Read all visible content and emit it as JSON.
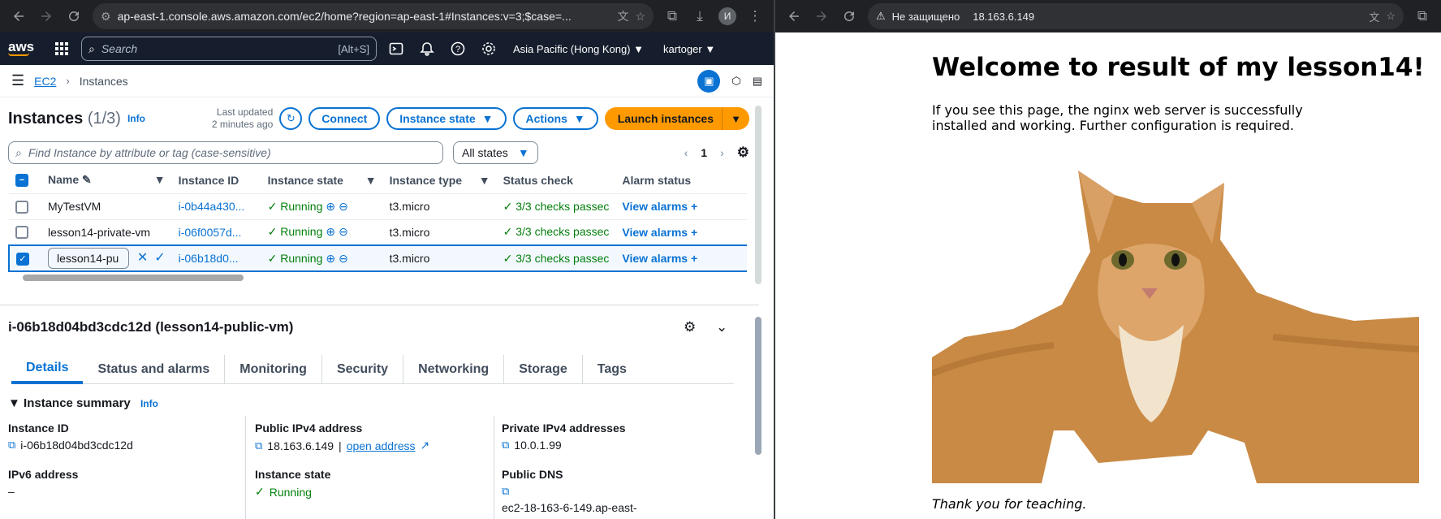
{
  "left_browser": {
    "url": "ap-east-1.console.aws.amazon.com/ec2/home?region=ap-east-1#Instances:v=3;$case=...",
    "profile_initial": "И"
  },
  "aws_nav": {
    "logo": "aws",
    "search_placeholder": "Search",
    "search_shortcut": "[Alt+S]",
    "region": "Asia Pacific (Hong Kong)",
    "user": "kartoger"
  },
  "breadcrumb": {
    "root": "EC2",
    "current": "Instances"
  },
  "instances": {
    "title": "Instances",
    "count": "(1/3)",
    "info": "Info",
    "last_updated_1": "Last updated",
    "last_updated_2": "2 minutes ago",
    "connect": "Connect",
    "instance_state": "Instance state",
    "actions": "Actions",
    "launch": "Launch instances",
    "filter_placeholder": "Find Instance by attribute or tag (case-sensitive)",
    "all_states": "All states",
    "page": "1",
    "columns": [
      "Name",
      "Instance ID",
      "Instance state",
      "Instance type",
      "Status check",
      "Alarm status"
    ],
    "rows": [
      {
        "name": "MyTestVM",
        "id": "i-0b44a430...",
        "state": "Running",
        "type": "t3.micro",
        "check": "3/3 checks passec",
        "alarm": "View alarms"
      },
      {
        "name": "lesson14-private-vm",
        "id": "i-06f0057d...",
        "state": "Running",
        "type": "t3.micro",
        "check": "3/3 checks passec",
        "alarm": "View alarms"
      },
      {
        "name": "lesson14-pu",
        "id": "i-06b18d0...",
        "state": "Running",
        "type": "t3.micro",
        "check": "3/3 checks passec",
        "alarm": "View alarms"
      }
    ]
  },
  "details": {
    "title": "i-06b18d04bd3cdc12d (lesson14-public-vm)",
    "tabs": [
      "Details",
      "Status and alarms",
      "Monitoring",
      "Security",
      "Networking",
      "Storage",
      "Tags"
    ],
    "summary": "Instance summary",
    "info": "Info",
    "instance_id_label": "Instance ID",
    "instance_id": "i-06b18d04bd3cdc12d",
    "public_ip_label": "Public IPv4 address",
    "public_ip": "18.163.6.149",
    "open_address": "open address",
    "private_ip_label": "Private IPv4 addresses",
    "private_ip": "10.0.1.99",
    "ipv6_label": "IPv6 address",
    "ipv6": "–",
    "state_label": "Instance state",
    "state": "Running",
    "dns_label": "Public DNS",
    "dns": "ec2-18-163-6-149.ap-east-"
  },
  "right_browser": {
    "insecure": "Не защищено",
    "url": "18.163.6.149"
  },
  "nginx_page": {
    "heading": "Welcome to result of my lesson14!",
    "paragraph": "If you see this page, the nginx web server is successfully installed and working. Further configuration is required.",
    "thanks": "Thank you for teaching."
  },
  "colors": {
    "aws_nav_bg": "#161e2d",
    "link_blue": "#0972d3",
    "primary_orange": "#ff9900",
    "running_green": "#037f0c"
  }
}
